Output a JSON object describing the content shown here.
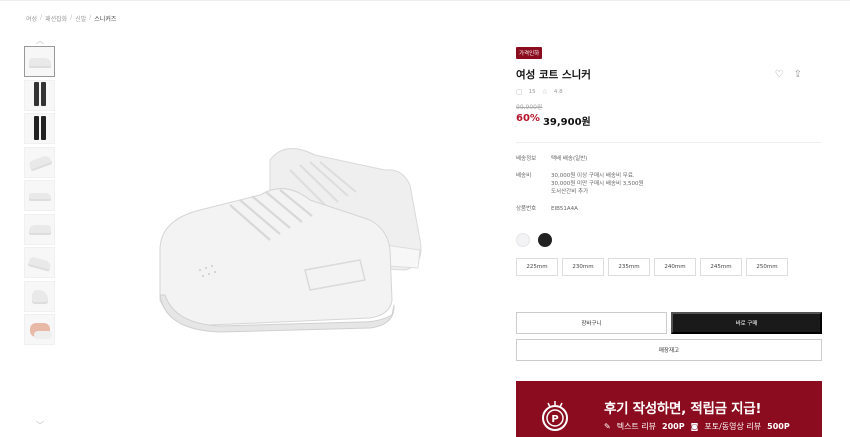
{
  "breadcrumb": {
    "items": [
      "여성",
      "패션잡화",
      "신발",
      "스니커즈"
    ],
    "separator": "/"
  },
  "thumbnails": {
    "up_arrow": "︿",
    "down_arrow": "﹀",
    "count": 9
  },
  "product": {
    "badge": "가격인하",
    "title": "여성 코트 스니커",
    "review_count": "15",
    "rating": "4.8",
    "original_price": "99,900원",
    "discount": "60%",
    "price": "39,900원",
    "wishlist_icon": "heart-icon",
    "share_icon": "share-icon"
  },
  "info": {
    "shipping_label": "배송정보",
    "shipping_value": "택배 배송(일반)",
    "fee_label": "배송비",
    "fee_lines": [
      "30,000원 이상 구매시 배송비 무료.",
      "30,000원 미만 구매시 배송비 3,500원",
      "도서산간비 추가"
    ],
    "code_label": "상품번호",
    "code_value": "EIB51A4A"
  },
  "colors": {
    "options": [
      "white",
      "black"
    ],
    "white_hex": "#f3f3f6",
    "black_hex": "#222222"
  },
  "sizes": [
    "225mm",
    "230mm",
    "235mm",
    "240mm",
    "245mm",
    "250mm"
  ],
  "buttons": {
    "cart": "장바구니",
    "buy": "바로 구매",
    "stock": "매장재고"
  },
  "banner": {
    "title": "후기 작성하면, 적립금 지급!",
    "text_review_label": "텍스트 리뷰",
    "text_review_points": "200P",
    "photo_review_label": "포토/동영상 리뷰",
    "photo_review_points": "500P",
    "color": "#8b0c1e"
  }
}
